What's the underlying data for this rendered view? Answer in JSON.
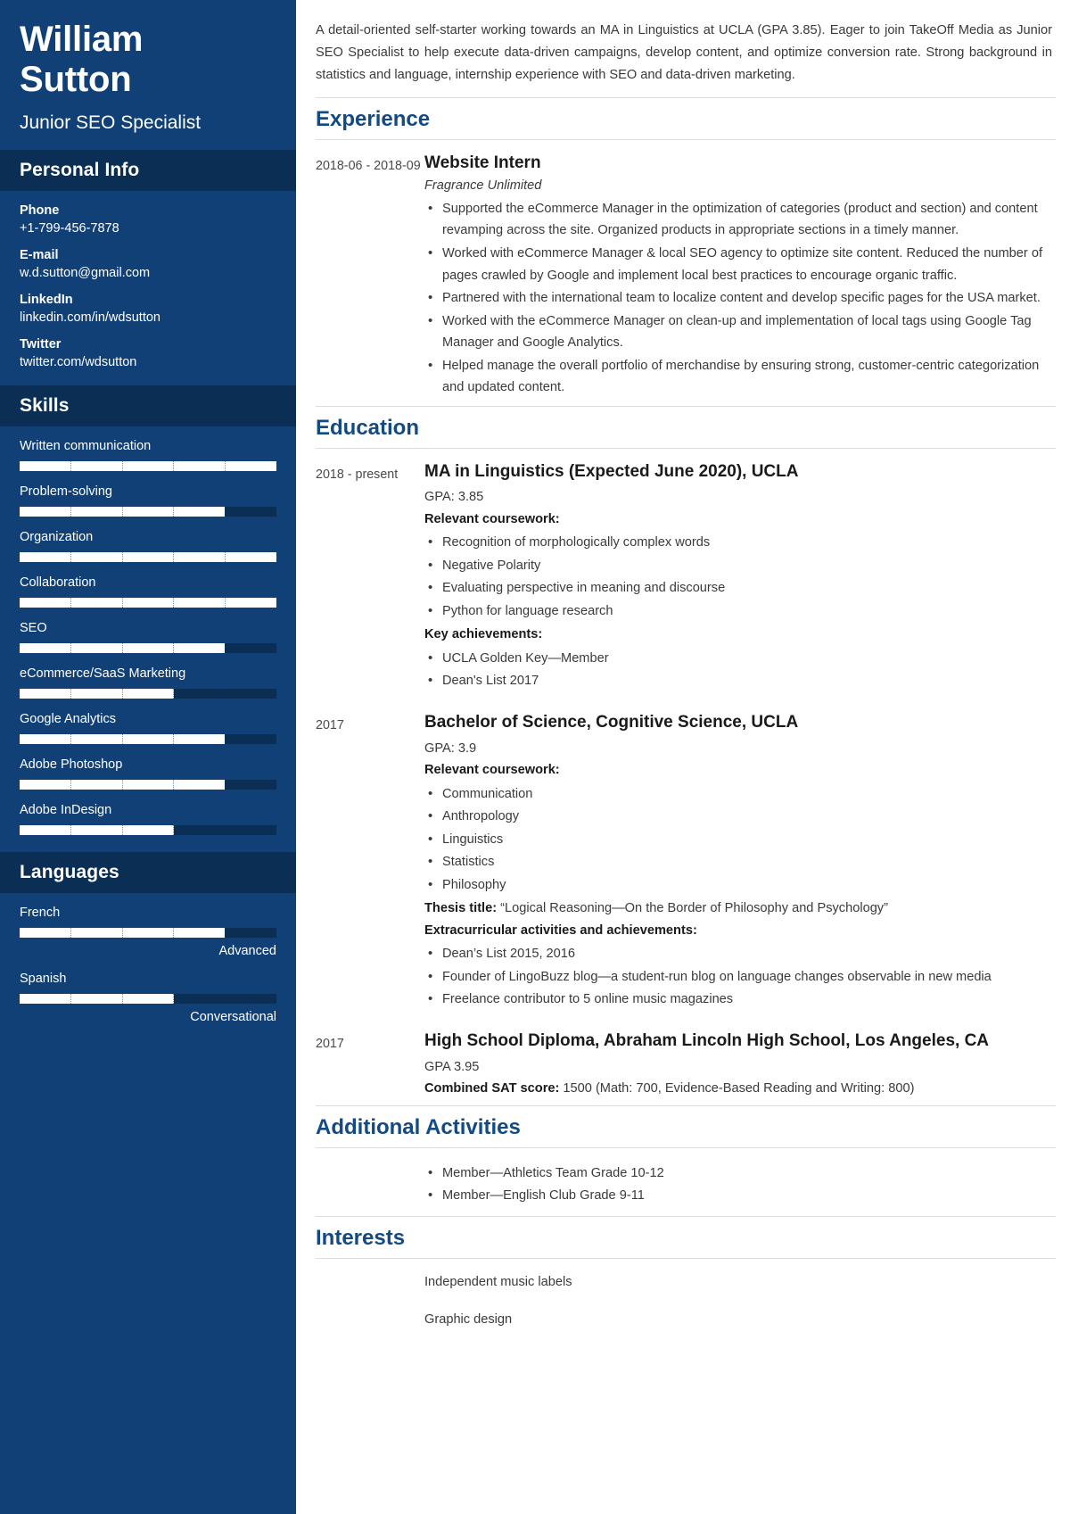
{
  "colors": {
    "sidebar_bg": "#114077",
    "sidebar_head_bg": "#0b2e55",
    "accent_heading": "#134a82",
    "bar_fill": "#ffffff",
    "bar_track": "#0b2e55"
  },
  "sidebar": {
    "name_line1": "William",
    "name_line2": "Sutton",
    "job_title": "Junior SEO Specialist",
    "personal_info": {
      "heading": "Personal Info",
      "items": [
        {
          "label": "Phone",
          "value": "+1-799-456-7878"
        },
        {
          "label": "E-mail",
          "value": "w.d.sutton@gmail.com"
        },
        {
          "label": "LinkedIn",
          "value": "linkedin.com/in/wdsutton"
        },
        {
          "label": "Twitter",
          "value": "twitter.com/wdsutton"
        }
      ]
    },
    "skills": {
      "heading": "Skills",
      "items": [
        {
          "name": "Written communication",
          "level": 5,
          "max": 5
        },
        {
          "name": "Problem-solving",
          "level": 4,
          "max": 5
        },
        {
          "name": "Organization",
          "level": 5,
          "max": 5
        },
        {
          "name": "Collaboration",
          "level": 5,
          "max": 5
        },
        {
          "name": "SEO",
          "level": 4,
          "max": 5
        },
        {
          "name": "eCommerce/SaaS Marketing",
          "level": 3,
          "max": 5
        },
        {
          "name": "Google Analytics",
          "level": 4,
          "max": 5
        },
        {
          "name": "Adobe Photoshop",
          "level": 4,
          "max": 5
        },
        {
          "name": "Adobe InDesign",
          "level": 3,
          "max": 5
        }
      ]
    },
    "languages": {
      "heading": "Languages",
      "items": [
        {
          "name": "French",
          "level": 4,
          "max": 5,
          "level_label": "Advanced"
        },
        {
          "name": "Spanish",
          "level": 3,
          "max": 5,
          "level_label": "Conversational"
        }
      ]
    }
  },
  "main": {
    "summary": "A detail-oriented self-starter working towards an MA in Linguistics at UCLA (GPA 3.85). Eager to join TakeOff Media as Junior SEO Specialist to help execute data-driven campaigns, develop content, and optimize conversion rate. Strong background in statistics and language, internship experience with SEO and data-driven marketing.",
    "experience": {
      "heading": "Experience",
      "entries": [
        {
          "date": "2018-06 - 2018-09",
          "title": "Website Intern",
          "company": "Fragrance Unlimited",
          "bullets": [
            "Supported the eCommerce Manager in the optimization of categories (product and section) and content revamping across the site. Organized products in appropriate sections in a timely manner.",
            "Worked with eCommerce Manager & local SEO agency to optimize site content. Reduced the number of pages crawled by Google and implement local best practices to encourage organic traffic.",
            "Partnered with the international team to localize content and develop specific pages for the USA market.",
            "Worked with the eCommerce Manager on clean-up and implementation of local tags using Google Tag Manager and Google Analytics.",
            "Helped manage the overall portfolio of merchandise by ensuring strong, customer-centric categorization and updated content."
          ]
        }
      ]
    },
    "education": {
      "heading": "Education",
      "entries": [
        {
          "date": "2018 - present",
          "title": "MA in Linguistics (Expected June 2020), UCLA",
          "gpa": "GPA: 3.85",
          "coursework_label": "Relevant coursework:",
          "coursework": [
            "Recognition of morphologically complex words",
            "Negative Polarity",
            "Evaluating perspective in meaning and discourse",
            "Python for language research"
          ],
          "achievements_label": "Key achievements:",
          "achievements": [
            "UCLA Golden Key—Member",
            "Dean's List 2017"
          ]
        },
        {
          "date": "2017",
          "title": "Bachelor of Science, Cognitive Science, UCLA",
          "gpa": "GPA: 3.9",
          "coursework_label": "Relevant coursework:",
          "coursework": [
            "Communication",
            "Anthropology",
            "Linguistics",
            "Statistics",
            "Philosophy"
          ],
          "thesis_label": "Thesis title:",
          "thesis_value": " “Logical Reasoning—On the Border of Philosophy and Psychology”",
          "extracurricular_label": "Extracurricular activities and achievements:",
          "extracurricular": [
            "Dean’s List 2015, 2016",
            "Founder of LingoBuzz blog—a student-run blog on language changes observable in new media",
            "Freelance contributor to 5 online music magazines"
          ]
        },
        {
          "date": "2017",
          "title": "High School Diploma, Abraham Lincoln High School, Los Angeles, CA",
          "gpa": "GPA 3.95",
          "sat_label": "Combined SAT score:",
          "sat_value": " 1500 (Math: 700, Evidence-Based Reading and Writing: 800)"
        }
      ]
    },
    "additional_activities": {
      "heading": "Additional Activities",
      "items": [
        "Member—Athletics Team Grade 10-12",
        "Member—English Club Grade 9-11"
      ]
    },
    "interests": {
      "heading": "Interests",
      "items": [
        "Independent music labels",
        "Graphic design"
      ]
    }
  }
}
